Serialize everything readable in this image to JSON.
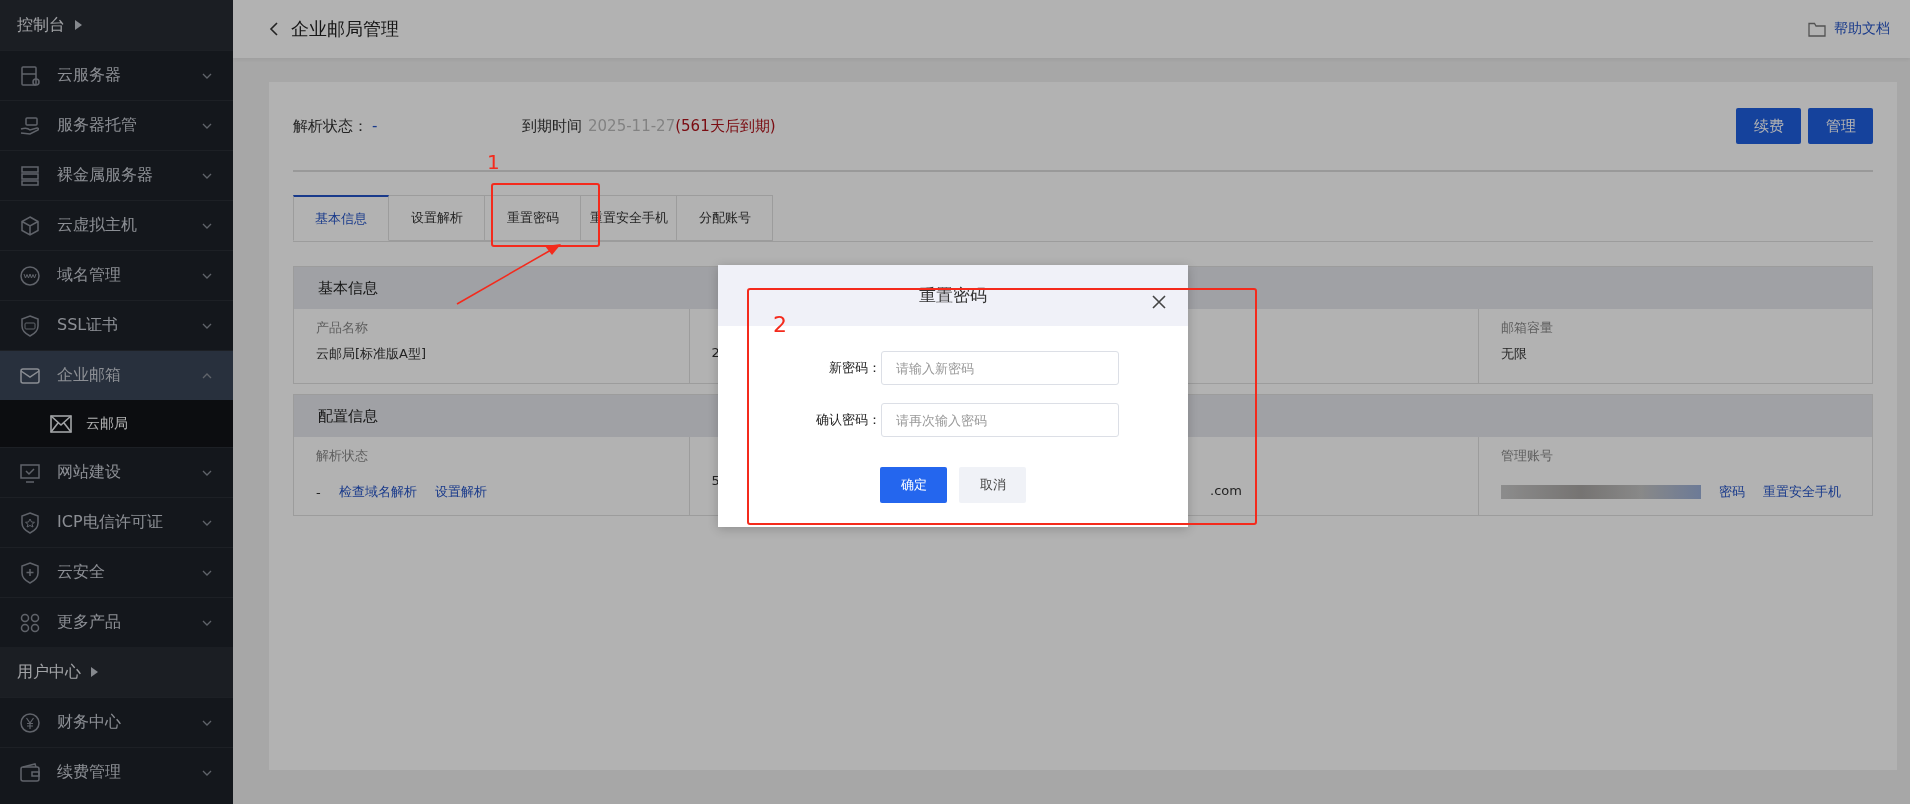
{
  "sidebar": {
    "items": [
      {
        "kind": "header",
        "label": "控制台"
      },
      {
        "kind": "menu",
        "label": "云服务器",
        "expanded": false,
        "selected": false
      },
      {
        "kind": "menu",
        "label": "服务器托管",
        "expanded": false,
        "selected": false
      },
      {
        "kind": "menu",
        "label": "裸金属服务器",
        "expanded": false,
        "selected": false
      },
      {
        "kind": "menu",
        "label": "云虚拟主机",
        "expanded": false,
        "selected": false
      },
      {
        "kind": "menu",
        "label": "域名管理",
        "expanded": false,
        "selected": false
      },
      {
        "kind": "menu",
        "label": "SSL证书",
        "expanded": false,
        "selected": false
      },
      {
        "kind": "menu",
        "label": "企业邮箱",
        "expanded": true,
        "selected": true,
        "children": [
          {
            "label": "云邮局",
            "selected": true
          }
        ]
      },
      {
        "kind": "menu",
        "label": "网站建设",
        "expanded": false,
        "selected": false
      },
      {
        "kind": "menu",
        "label": "ICP电信许可证",
        "expanded": false,
        "selected": false
      },
      {
        "kind": "menu",
        "label": "云安全",
        "expanded": false,
        "selected": false
      },
      {
        "kind": "menu",
        "label": "更多产品",
        "expanded": false,
        "selected": false
      },
      {
        "kind": "header",
        "label": "用户中心"
      },
      {
        "kind": "menu",
        "label": "财务中心",
        "expanded": false,
        "selected": false
      },
      {
        "kind": "menu",
        "label": "续费管理",
        "expanded": false,
        "selected": false
      }
    ]
  },
  "header": {
    "title": "企业邮局管理",
    "help_link": "帮助文档"
  },
  "status": {
    "parse_label": "解析状态：",
    "parse_value": "-",
    "expiry_label": "到期时间",
    "expiry_date": "2025-11-27",
    "expiry_note": "(561天后到期)"
  },
  "actions": [
    "续费",
    "管理"
  ],
  "tabs": [
    {
      "label": "基本信息",
      "selected": true
    },
    {
      "label": "设置解析",
      "selected": false
    },
    {
      "label": "重置密码",
      "selected": false
    },
    {
      "label": "重置安全手机",
      "selected": false
    },
    {
      "label": "分配账号",
      "selected": false
    }
  ],
  "sections": [
    {
      "title": "基本信息",
      "cells": [
        {
          "kind": "text",
          "label": "产品名称",
          "value": "云邮局[标准版A型]"
        },
        {
          "kind": "text",
          "value": "2"
        },
        {
          "kind": "covered"
        },
        {
          "kind": "text",
          "label": "邮箱容量",
          "value": "无限"
        }
      ]
    },
    {
      "title": "配置信息",
      "cells": [
        {
          "kind": "links",
          "label": "解析状态",
          "value": "-",
          "links": [
            "检查域名解析",
            "设置解析"
          ]
        },
        {
          "kind": "text",
          "value": "5"
        },
        {
          "kind": "tail",
          "value": ".com"
        },
        {
          "kind": "redacted",
          "label": "管理账号",
          "links": [
            "密码",
            "重置安全手机"
          ]
        }
      ]
    }
  ],
  "modal": {
    "title": "重置密码",
    "fields": [
      {
        "label": "新密码：",
        "placeholder": "请输入新密码"
      },
      {
        "label": "确认密码：",
        "placeholder": "请再次输入密码"
      }
    ],
    "buttons": [
      {
        "label": "确定",
        "kind": "primary"
      },
      {
        "label": "取消",
        "kind": "secondary"
      }
    ]
  },
  "annotations": [
    {
      "label": "1"
    },
    {
      "label": "2"
    }
  ]
}
